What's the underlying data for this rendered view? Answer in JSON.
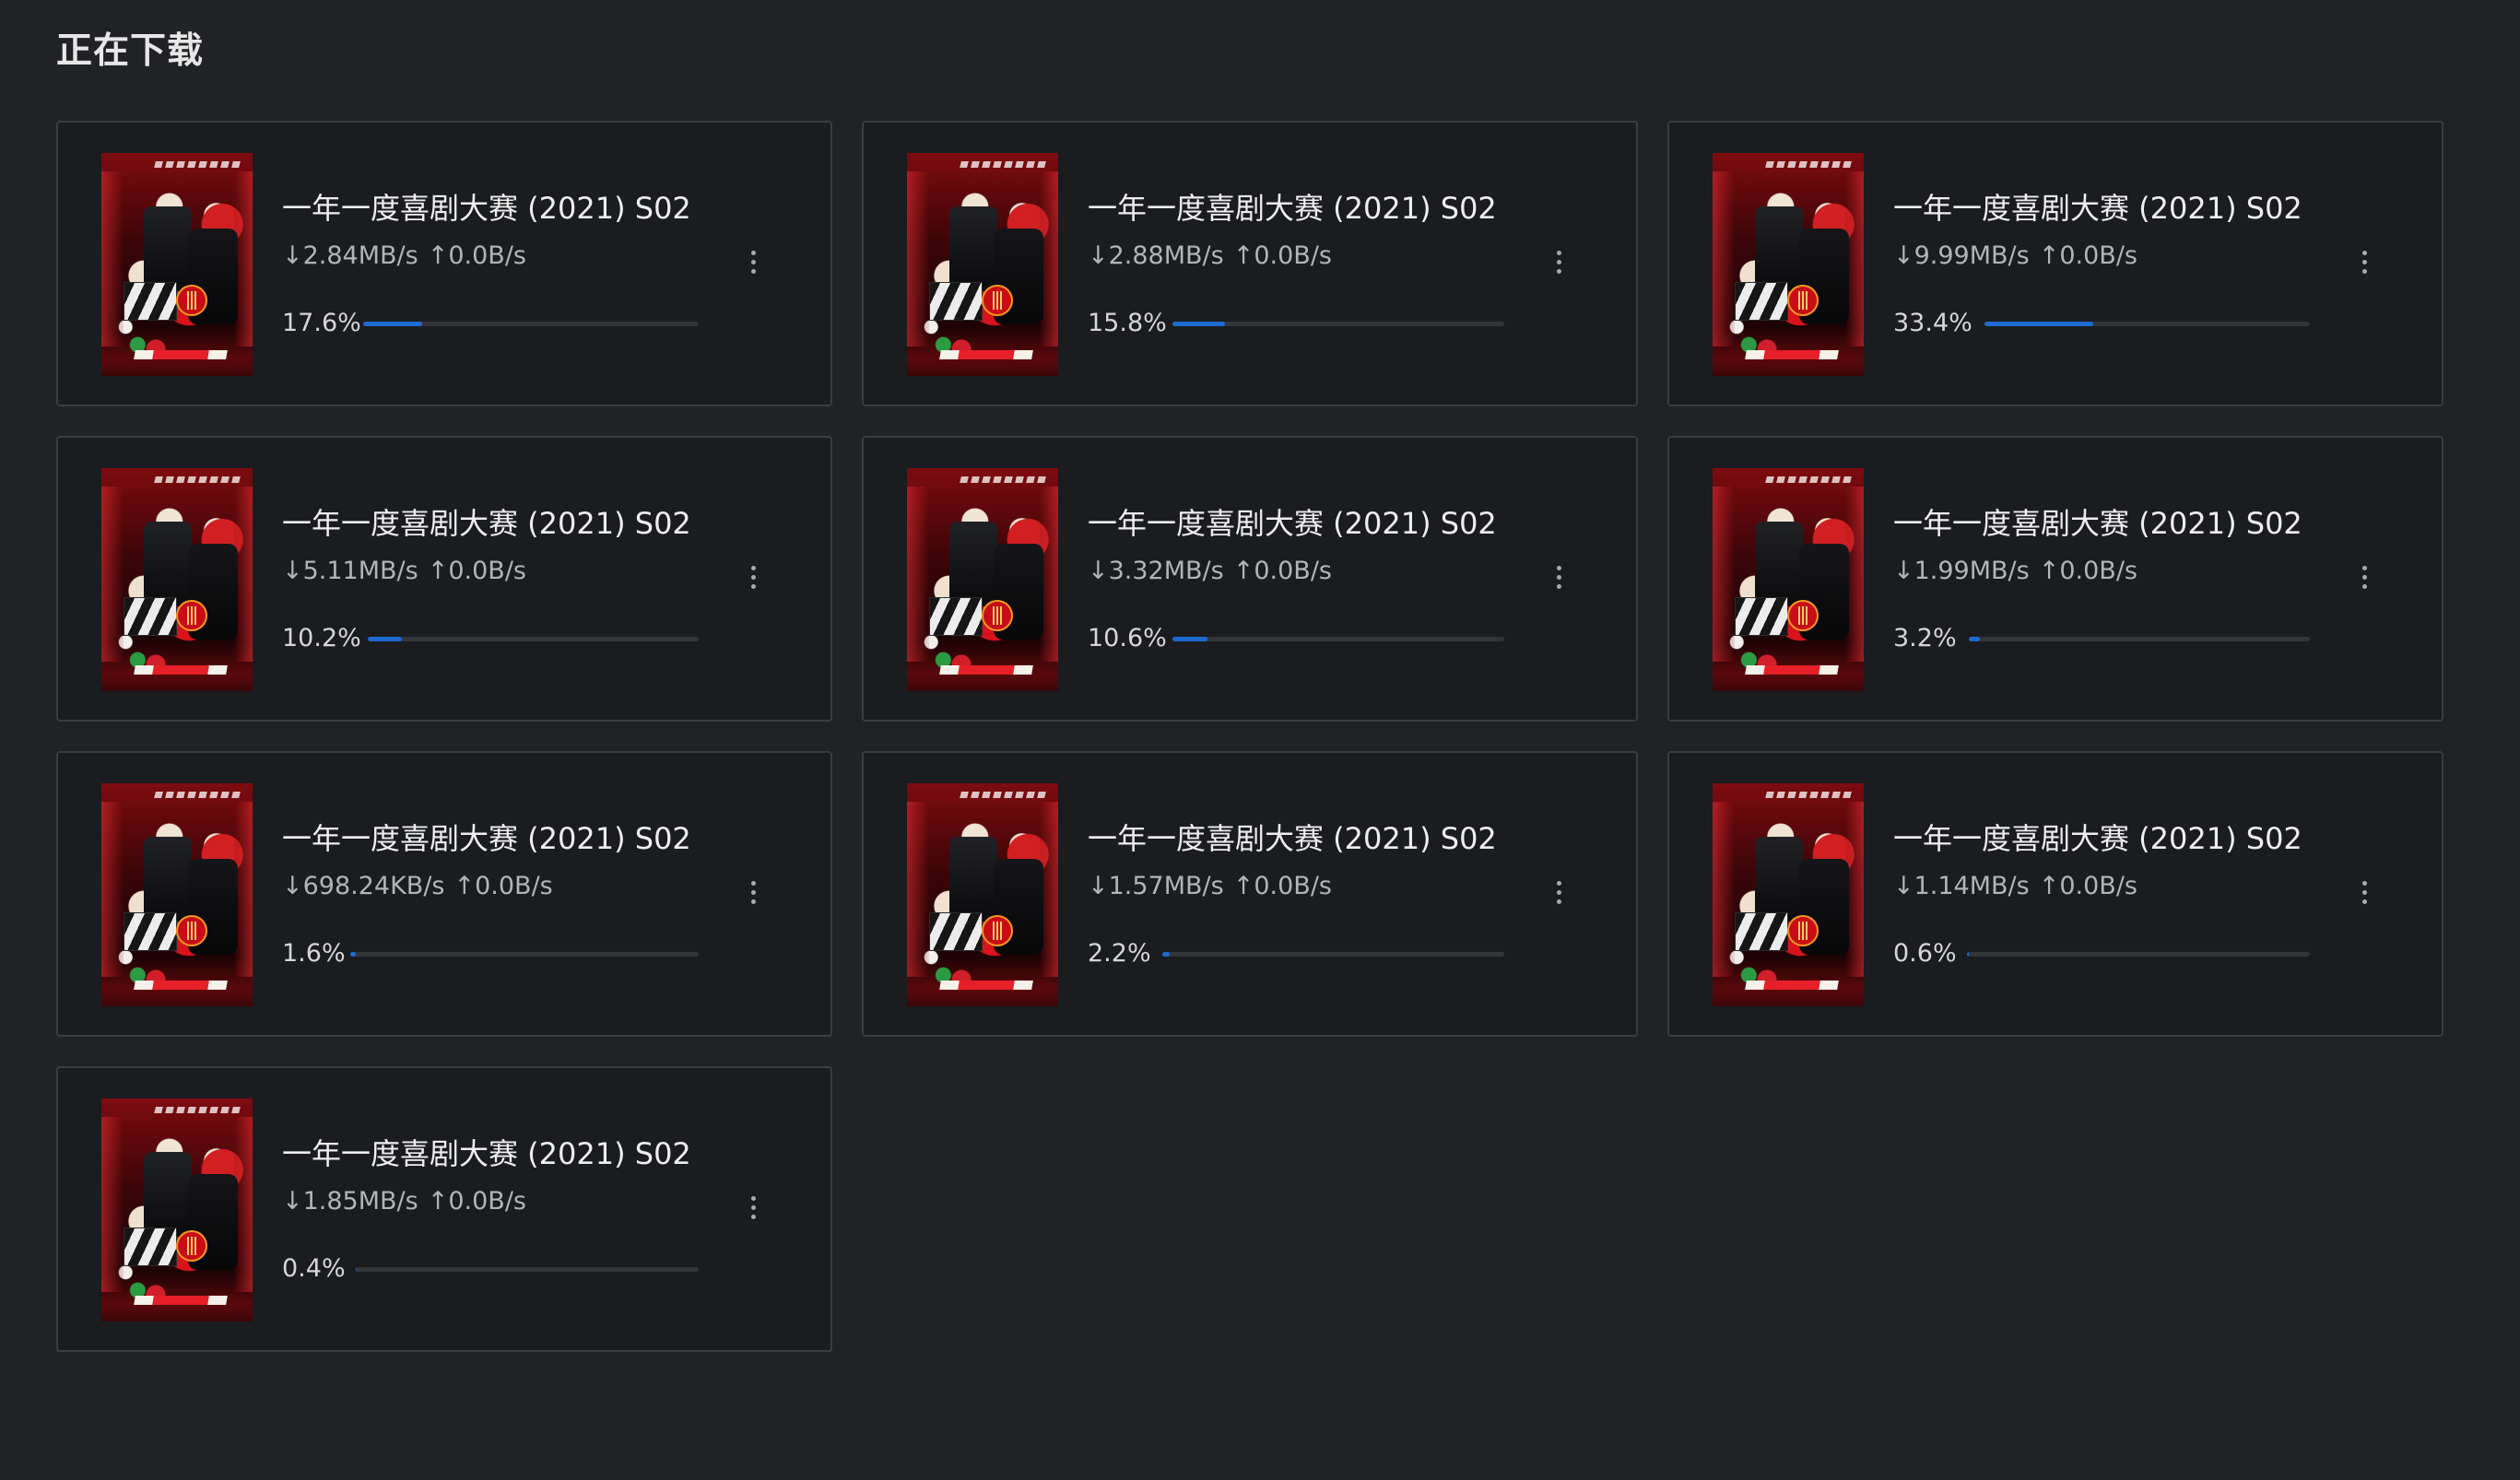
{
  "page": {
    "title": "正在下载"
  },
  "colors": {
    "background": "#212226",
    "card_background": "#1a1c1f",
    "card_border": "#3a3c40",
    "progress_fill": "#1d6bd0",
    "progress_track": "#343538"
  },
  "icons": {
    "download": "arrow-down-icon",
    "upload": "arrow-up-icon",
    "menu": "more-vertical-icon"
  },
  "downloads": [
    {
      "title": "一年一度喜剧大赛 (2021) S02",
      "download_speed": "↓2.84MB/s",
      "upload_speed": "↑0.0B/s",
      "progress_label": "17.6%",
      "progress": 0.176
    },
    {
      "title": "一年一度喜剧大赛 (2021) S02",
      "download_speed": "↓2.88MB/s",
      "upload_speed": "↑0.0B/s",
      "progress_label": "15.8%",
      "progress": 0.158
    },
    {
      "title": "一年一度喜剧大赛 (2021) S02",
      "download_speed": "↓9.99MB/s",
      "upload_speed": "↑0.0B/s",
      "progress_label": "33.4%",
      "progress": 0.334
    },
    {
      "title": "一年一度喜剧大赛 (2021) S02",
      "download_speed": "↓5.11MB/s",
      "upload_speed": "↑0.0B/s",
      "progress_label": "10.2%",
      "progress": 0.102
    },
    {
      "title": "一年一度喜剧大赛 (2021) S02",
      "download_speed": "↓3.32MB/s",
      "upload_speed": "↑0.0B/s",
      "progress_label": "10.6%",
      "progress": 0.106
    },
    {
      "title": "一年一度喜剧大赛 (2021) S02",
      "download_speed": "↓1.99MB/s",
      "upload_speed": "↑0.0B/s",
      "progress_label": "3.2%",
      "progress": 0.032
    },
    {
      "title": "一年一度喜剧大赛 (2021) S02",
      "download_speed": "↓698.24KB/s",
      "upload_speed": "↑0.0B/s",
      "progress_label": "1.6%",
      "progress": 0.016
    },
    {
      "title": "一年一度喜剧大赛 (2021) S02",
      "download_speed": "↓1.57MB/s",
      "upload_speed": "↑0.0B/s",
      "progress_label": "2.2%",
      "progress": 0.022
    },
    {
      "title": "一年一度喜剧大赛 (2021) S02",
      "download_speed": "↓1.14MB/s",
      "upload_speed": "↑0.0B/s",
      "progress_label": "0.6%",
      "progress": 0.006
    },
    {
      "title": "一年一度喜剧大赛 (2021) S02",
      "download_speed": "↓1.85MB/s",
      "upload_speed": "↑0.0B/s",
      "progress_label": "0.4%",
      "progress": 0.004
    }
  ]
}
